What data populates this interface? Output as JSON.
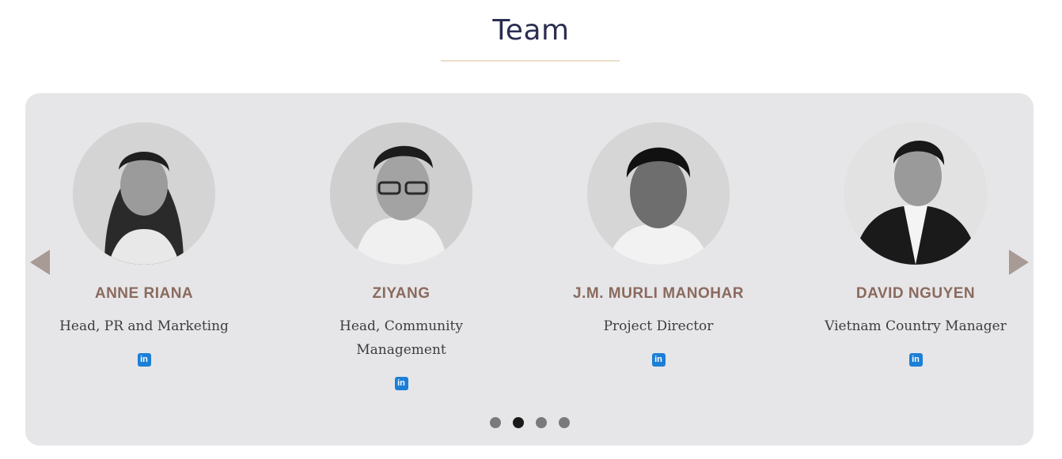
{
  "section": {
    "title": "Team"
  },
  "carousel": {
    "prev_label": "Previous",
    "next_label": "Next",
    "members": [
      {
        "name": "ANNE RIANA",
        "role": "Head, PR and Marketing",
        "linkedin_icon": "linkedin-icon"
      },
      {
        "name": "ZIYANG",
        "role": "Head, Community Management",
        "linkedin_icon": "linkedin-icon"
      },
      {
        "name": "J.M. MURLI MANOHAR",
        "role": "Project Director",
        "linkedin_icon": "linkedin-icon"
      },
      {
        "name": "DAVID NGUYEN",
        "role": "Vietnam Country Manager",
        "linkedin_icon": "linkedin-icon"
      }
    ],
    "pagination": {
      "total": 4,
      "active_index": 1
    }
  },
  "colors": {
    "title": "#2b2e52",
    "name": "#8b6a5e",
    "linkedin": "#1c7fd6",
    "panel": "#e6e6e8",
    "arrow": "#a89a94"
  }
}
